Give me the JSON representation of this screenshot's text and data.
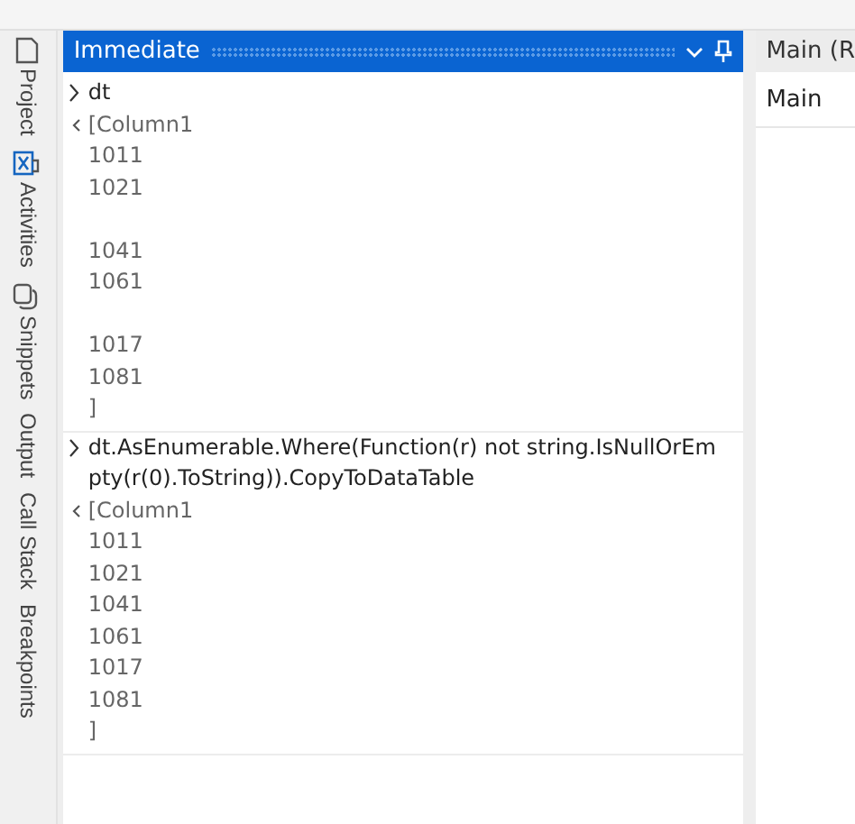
{
  "side_tabs": [
    {
      "label": "Project",
      "kind": "document"
    },
    {
      "label": "Activities",
      "kind": "activities"
    },
    {
      "label": "Snippets",
      "kind": "snippets"
    },
    {
      "label": "Output",
      "kind": "plain"
    },
    {
      "label": "Call Stack",
      "kind": "plain"
    },
    {
      "label": "Breakpoints",
      "kind": "plain"
    }
  ],
  "immediate": {
    "title": "Immediate",
    "entries": [
      {
        "input": "dt",
        "output": [
          [
            "[Column1",
            "1011",
            "1021"
          ],
          [
            "1041",
            "1061"
          ],
          [
            "1017",
            "1081",
            "]"
          ]
        ]
      },
      {
        "input": "dt.AsEnumerable.Where(Function(r) not string.IsNullOrEmpty(r(0).ToString)).CopyToDataTable",
        "output": [
          [
            "[Column1",
            "1011",
            "1021",
            "1041",
            "1061",
            "1017",
            "1081",
            "]"
          ]
        ]
      }
    ]
  },
  "right_panel": {
    "title": "Main (R",
    "items": [
      "Main"
    ]
  }
}
